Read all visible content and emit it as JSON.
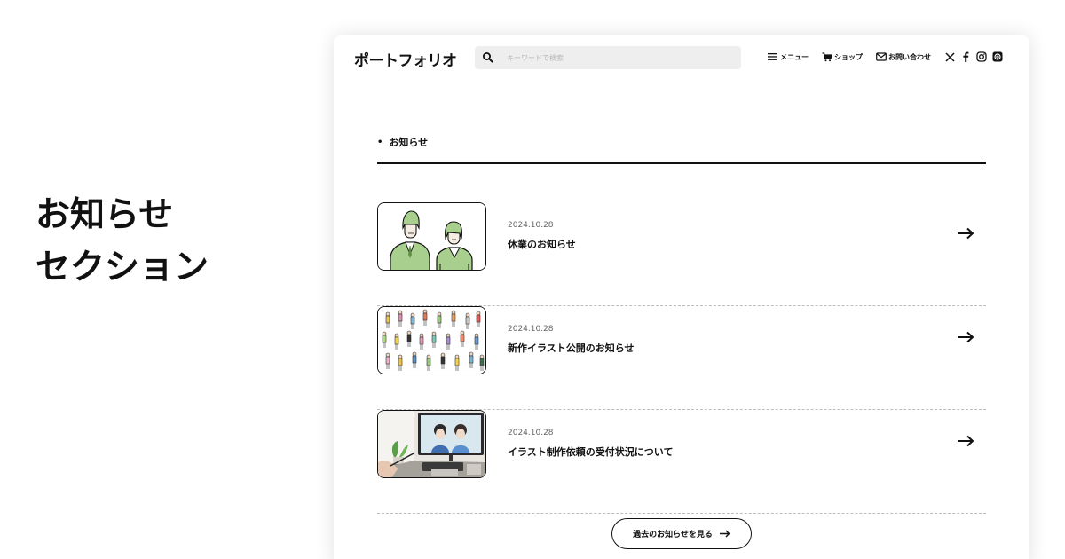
{
  "caption": {
    "line1": "お知らせ",
    "line2": "セクション"
  },
  "header": {
    "logo": "ポートフォリオ",
    "search_placeholder": "キーワードで検索",
    "nav": [
      {
        "label": "メニュー",
        "icon": "hamburger-icon"
      },
      {
        "label": "ショップ",
        "icon": "cart-icon"
      },
      {
        "label": "お問い合わせ",
        "icon": "mail-icon"
      }
    ],
    "social": [
      "x-icon",
      "facebook-icon",
      "instagram-icon",
      "threads-icon"
    ]
  },
  "section": {
    "title": "お知らせ"
  },
  "news": [
    {
      "date": "2024.10.28",
      "title": "休業のお知らせ",
      "thumbnail": "bowing-staff-illustration"
    },
    {
      "date": "2024.10.28",
      "title": "新作イラスト公開のお知らせ",
      "thumbnail": "people-illustrations"
    },
    {
      "date": "2024.10.28",
      "title": "イラスト制作依頼の受付状況について",
      "thumbnail": "artist-workspace-photo"
    }
  ],
  "more_button": {
    "label": "過去のお知らせを見る"
  },
  "colors": {
    "text": "#111111",
    "search_bg": "#eeeeee",
    "divider": "#bdbdbd",
    "illustration_green": "#a8cf8e",
    "background": "#ffffff"
  }
}
